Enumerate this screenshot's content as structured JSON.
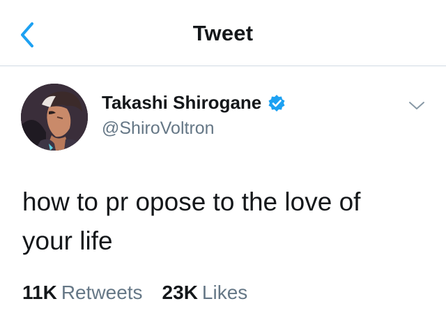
{
  "header": {
    "title": "Tweet",
    "back_icon": "chevron-left-icon",
    "accent_color": "#1da1f2"
  },
  "tweet": {
    "author": {
      "display_name": "Takashi Shirogane",
      "handle": "@ShiroVoltron",
      "verified": true,
      "verified_color": "#1da1f2"
    },
    "menu_icon": "chevron-down-icon",
    "text_line1": "how to pr opose to the love of",
    "text_line2": "your life",
    "stats": {
      "retweets_count": "11K",
      "retweets_label": "Retweets",
      "likes_count": "23K",
      "likes_label": "Likes"
    }
  }
}
